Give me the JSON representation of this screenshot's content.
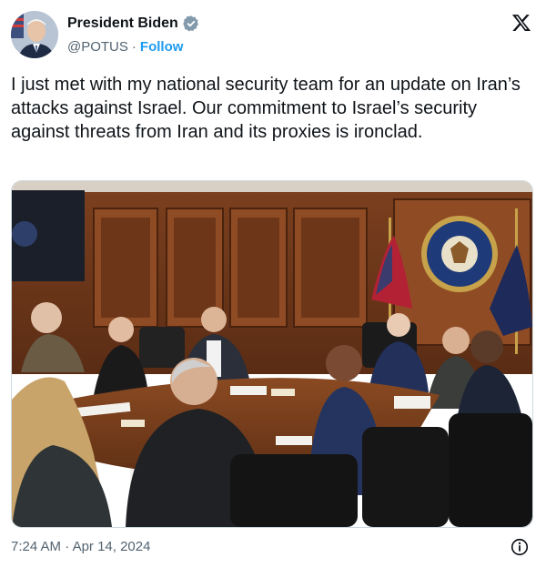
{
  "author": {
    "name": "President Biden",
    "handle": "@POTUS",
    "separator": "·",
    "follow_label": "Follow",
    "verified_icon": "verified-badge-icon",
    "avatar_icon": "avatar"
  },
  "tweet": {
    "text": "I just met with my national security team for an update on Iran’s attacks against Israel. Our commitment to Israel’s security against threats from Iran and its proxies is ironclad.",
    "time": "7:24 AM",
    "separator": "·",
    "date": "Apr 14, 2024"
  },
  "icons": {
    "platform": "x-logo-icon",
    "info": "info-icon"
  },
  "colors": {
    "accent": "#1d9bf0",
    "text": "#0f1419",
    "secondary": "#536471"
  }
}
